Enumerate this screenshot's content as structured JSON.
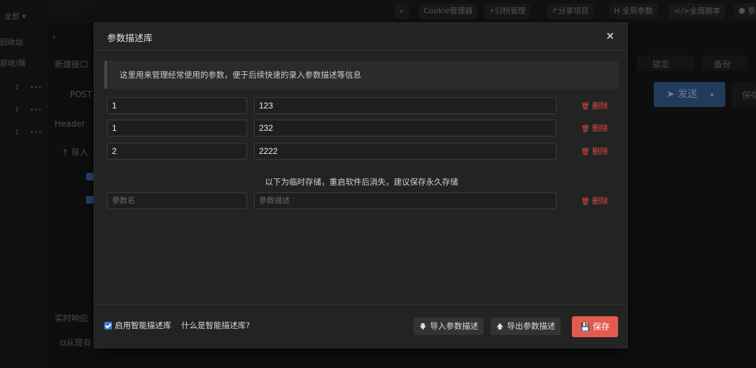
{
  "background": {
    "sidebar": {
      "filter_label": "全部",
      "item1": "回收站",
      "item2": "部收/展"
    },
    "topbar": {
      "expand": "»",
      "cookie": "Cookie管理器",
      "archive": "归档管理",
      "share": "分享项目",
      "global_params": "H 全局参数",
      "global_script": "全局脚本",
      "more": "参"
    },
    "main": {
      "new_api": "新建接口",
      "lock": "锁定",
      "backup": "备份",
      "method": "POST",
      "send": "发送",
      "save_partial": "保存",
      "header_tab": "Header",
      "import": "导入",
      "realtime": "实时响应",
      "from_existing": "从现有"
    }
  },
  "modal": {
    "title": "参数描述库",
    "close": "×",
    "info": "这里用来管理经常使用的参数，便于后续快速的录入参数描述等信息",
    "rows": [
      {
        "name": "1",
        "desc": "123",
        "delete": "删除"
      },
      {
        "name": "1",
        "desc": "232",
        "delete": "删除"
      },
      {
        "name": "2",
        "desc": "2222",
        "delete": "删除"
      }
    ],
    "temp_note": "以下为临时存储，重启软件后消失，建议保存永久存储",
    "new_row": {
      "name_placeholder": "参数名",
      "desc_placeholder": "参数描述",
      "delete": "删除"
    },
    "footer": {
      "enable_label": "启用智能描述库",
      "enabled": true,
      "help_link": "什么是智能描述库?",
      "import_btn": "导入参数描述",
      "export_btn": "导出参数描述",
      "save_btn": "保存"
    }
  },
  "colors": {
    "danger": "#e0483e",
    "save_bg": "#e35a50",
    "accent": "#3d7bd8",
    "send_bg": "#3f6aa8"
  },
  "icons": [
    "trash-icon",
    "floppy-icon",
    "arrow-down-icon",
    "arrow-up-icon",
    "close-icon",
    "paper-plane-icon"
  ]
}
